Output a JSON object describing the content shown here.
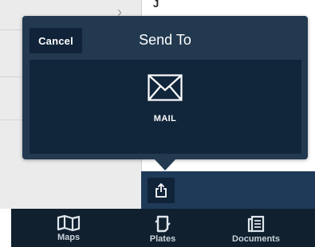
{
  "background": {
    "letter": "J"
  },
  "popover": {
    "title": "Send To",
    "cancel_label": "Cancel",
    "options": [
      {
        "label": "MAIL",
        "icon": "mail-icon"
      }
    ]
  },
  "share_button": {
    "icon": "share-icon"
  },
  "tabbar": {
    "tabs": [
      {
        "label": "Maps",
        "icon": "map-icon"
      },
      {
        "label": "Plates",
        "icon": "plates-icon"
      },
      {
        "label": "Documents",
        "icon": "documents-icon"
      }
    ]
  },
  "colors": {
    "popover": "#22394f",
    "panel": "#12263b",
    "tabbar": "#10202f",
    "strip": "#1f3a58"
  }
}
